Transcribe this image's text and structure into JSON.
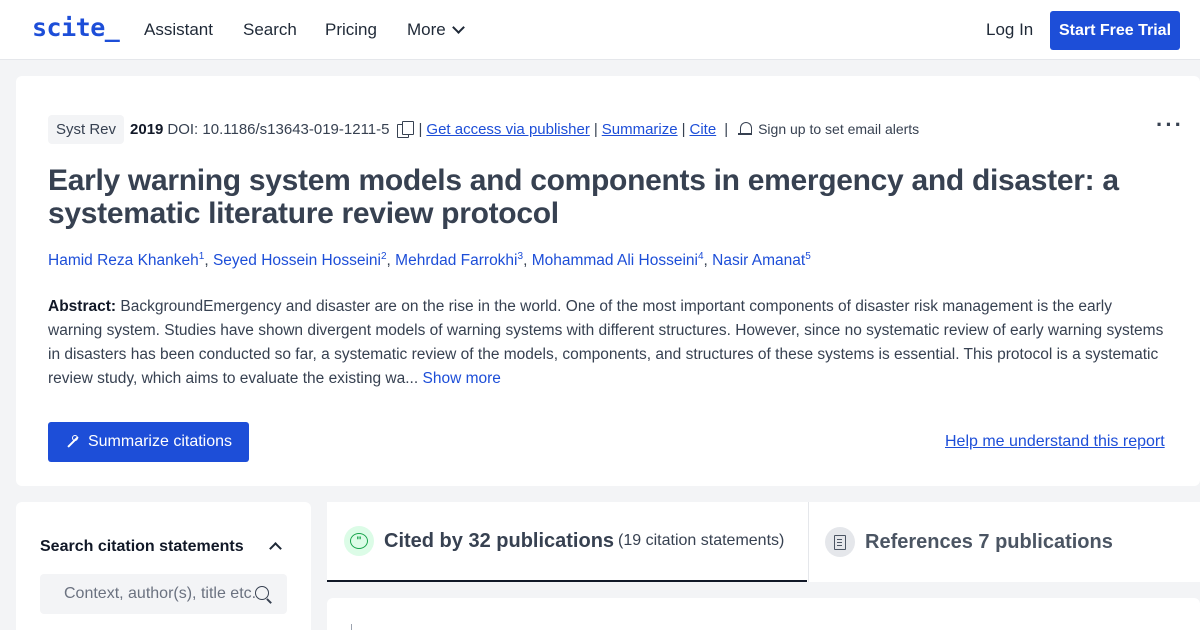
{
  "header": {
    "logo": "scite_",
    "nav": [
      "Assistant",
      "Search",
      "Pricing",
      "More"
    ],
    "login": "Log In",
    "trial_button": "Start Free Trial"
  },
  "paper": {
    "journal": "Syst Rev",
    "year": "2019",
    "doi": "DOI: 10.1186/s13643-019-1211-5",
    "links": {
      "access": "Get access via publisher",
      "summarize": "Summarize",
      "cite": "Cite"
    },
    "alerts": "Sign up to set email alerts",
    "more": "···",
    "title": "Early warning system models and components in emergency and disaster: a systematic literature review protocol",
    "authors": [
      {
        "name": "Hamid Reza Khankeh",
        "sup": "1"
      },
      {
        "name": "Seyed Hossein Hosseini",
        "sup": "2"
      },
      {
        "name": "Mehrdad Farrokhi",
        "sup": "3"
      },
      {
        "name": "Mohammad Ali Hosseini",
        "sup": "4"
      },
      {
        "name": "Nasir Amanat",
        "sup": "5"
      }
    ],
    "abstract_label": "Abstract:",
    "abstract_text": "BackgroundEmergency and disaster are on the rise in the world. One of the most important components of disaster risk management is the early warning system. Studies have shown divergent models of warning systems with different structures. However, since no systematic review of early warning systems in disasters has been conducted so far, a systematic review of the models, components, and structures of these systems is essential. This protocol is a systematic review study, which aims to evaluate the existing wa...",
    "show_more": "Show more",
    "summarize_button": "Summarize citations",
    "help_link": "Help me understand this report"
  },
  "search_panel": {
    "title": "Search citation statements",
    "placeholder": "Context, author(s), title etc."
  },
  "tabs": {
    "cited_main": "Cited by 32 publications",
    "cited_sub": "(19 citation statements)",
    "refs_main": "References 7 publications"
  },
  "icons": {
    "copy": "copy-icon",
    "bell": "bell-icon",
    "wand": "wand-icon",
    "search": "search-icon",
    "quote": "quote-icon",
    "document": "document-icon"
  },
  "colors": {
    "brand": "#1d4ed8",
    "background": "#f3f4f6",
    "cited_accent": "#16a34a"
  }
}
